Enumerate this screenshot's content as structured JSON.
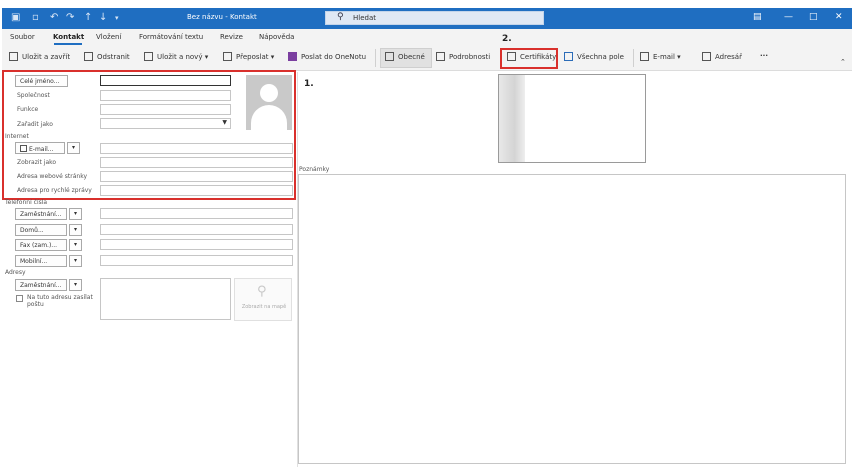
{
  "window": {
    "title": "Bez názvu - Kontakt",
    "search_placeholder": "Hledat"
  },
  "menu": [
    "Soubor",
    "Kontakt",
    "Vložení",
    "Formátování textu",
    "Revize",
    "Nápověda"
  ],
  "ribbon": {
    "save_close": "Uložit a zavřít",
    "delete": "Odstranit",
    "save_new": "Uložit a nový",
    "forward": "Přeposlat",
    "onenote": "Poslat do OneNotu",
    "general": "Obecné",
    "details": "Podrobnosti",
    "certificates": "Certifikáty",
    "all_fields": "Všechna pole",
    "email": "E-mail",
    "address_book": "Adresář",
    "more": "···"
  },
  "annotations": {
    "step1": "1.",
    "step2": "2."
  },
  "form": {
    "full_name_btn": "Celé jméno...",
    "company": "Společnost",
    "job_title": "Funkce",
    "file_as": "Zařadit jako",
    "internet_section": "Internet",
    "email_btn": "E-mail...",
    "display_as": "Zobrazit jako",
    "web_page": "Adresa webové stránky",
    "im_address": "Adresa pro rychlé zprávy",
    "phones_section": "Telefonní čísla",
    "phone_business": "Zaměstnání...",
    "phone_home": "Domů...",
    "phone_fax": "Fax (zam.)...",
    "phone_mobile": "Mobilní...",
    "addresses_section": "Adresy",
    "address_business": "Zaměstnání...",
    "mailing_address": "Na tuto adresu zasílat poštu",
    "map_it": "Zobrazit na mapě",
    "notes": "Poznámky"
  },
  "colors": {
    "titlebar": "#1f6ec1",
    "highlight": "#d9302c"
  }
}
